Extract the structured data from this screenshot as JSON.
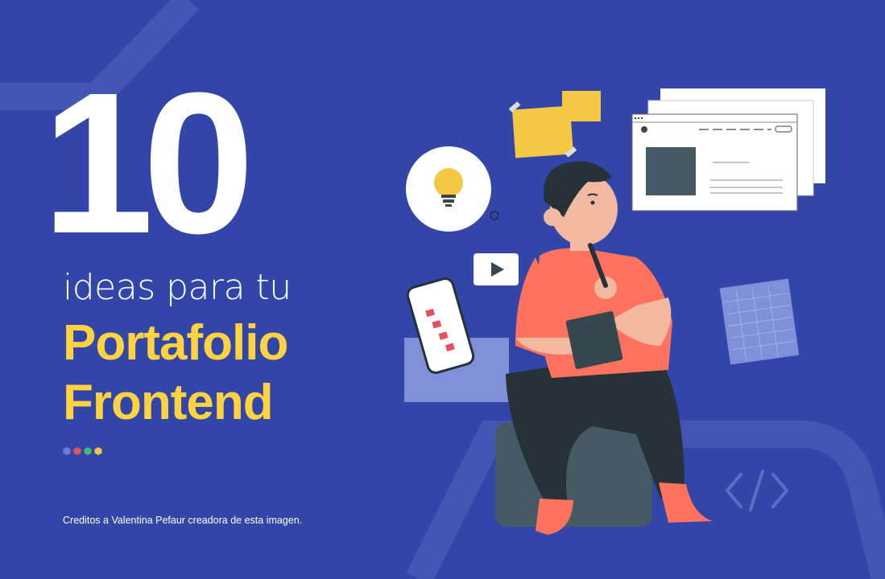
{
  "headline": {
    "number": "10",
    "subtitle": "ideas para tu",
    "highlight_line1": "Portafolio",
    "highlight_line2": "Frontend"
  },
  "credits": "Creditos a Valentina Pefaur creadora de esta imagen.",
  "colors": {
    "background": "#3146A8",
    "highlight": "#FFD23F",
    "dot_blue": "#6C7FD8",
    "dot_red": "#E8505B",
    "dot_green": "#3DBE6B",
    "dot_yellow": "#F5C343"
  },
  "icons": [
    "lightbulb-icon",
    "play-icon",
    "code-icon"
  ]
}
